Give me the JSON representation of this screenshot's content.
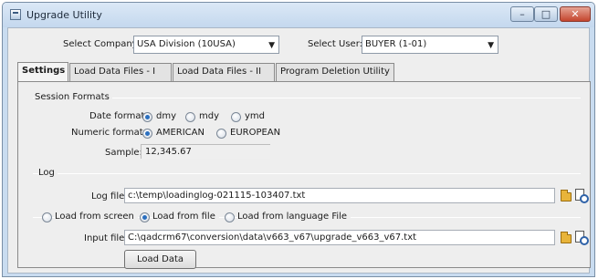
{
  "window": {
    "title": "Upgrade Utility",
    "min_glyph": "–",
    "max_glyph": "□",
    "close_glyph": "✕"
  },
  "header": {
    "company_label": "Select Company:",
    "company_value": "USA Division (10USA)",
    "user_label": "Select User:",
    "user_value": "BUYER (1-01)"
  },
  "tabs": [
    "Settings",
    "Load Data Files - I",
    "Load Data Files - II",
    "Program Deletion Utility"
  ],
  "session": {
    "group_title": "Session Formats",
    "date_label": "Date format:",
    "date_options": [
      "dmy",
      "mdy",
      "ymd"
    ],
    "date_selected": "dmy",
    "numeric_label": "Numeric format:",
    "numeric_options": [
      "AMERICAN",
      "EUROPEAN"
    ],
    "numeric_selected": "AMERICAN",
    "sample_label": "Sample:",
    "sample_value": "12,345.67"
  },
  "log": {
    "group_title": "Log",
    "file_label": "Log file:",
    "file_value": "c:\\temp\\loadinglog-021115-103407.txt"
  },
  "load": {
    "options": [
      "Load from screen",
      "Load from file",
      "Load from language File"
    ],
    "selected": "Load from file",
    "input_label": "Input file:",
    "input_value": "C:\\qadcrm67\\conversion\\data\\v663_v67\\upgrade_v663_v67.txt",
    "button_label": "Load Data"
  }
}
